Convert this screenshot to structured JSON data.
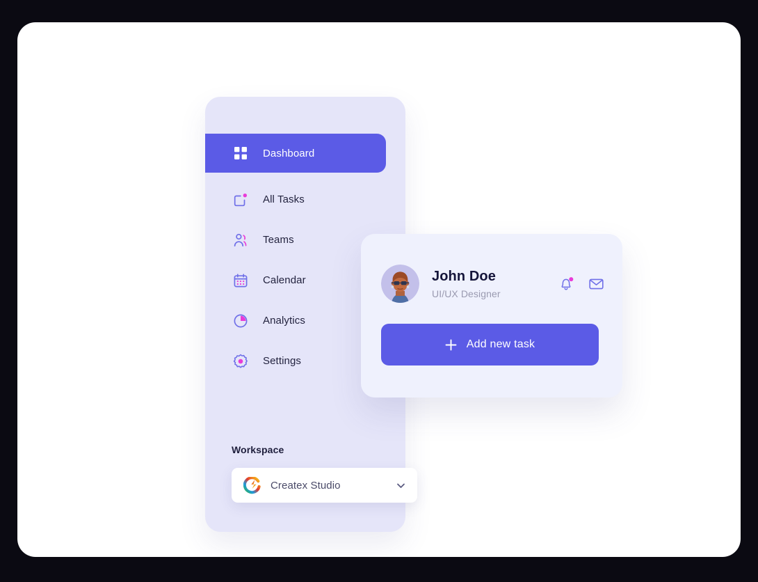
{
  "theme": {
    "page_background": "#0b0a12",
    "card_background": "#ffffff",
    "sidebar_background": "#e5e5f9",
    "accent": "#5b5be6",
    "accent_secondary": "#e93bd8",
    "profile_card_background": "#eff1fd",
    "text_dark": "#23233f",
    "text_muted": "#9a9ab0"
  },
  "sidebar": {
    "items": [
      {
        "label": "Dashboard",
        "icon": "grid-icon",
        "active": true
      },
      {
        "label": "All Tasks",
        "icon": "tasks-icon",
        "active": false
      },
      {
        "label": "Teams",
        "icon": "teams-icon",
        "active": false
      },
      {
        "label": "Calendar",
        "icon": "calendar-icon",
        "active": false
      },
      {
        "label": "Analytics",
        "icon": "analytics-icon",
        "active": false
      },
      {
        "label": "Settings",
        "icon": "settings-icon",
        "active": false
      }
    ],
    "workspace": {
      "title": "Workspace",
      "selected": "Createx Studio",
      "logo_icon": "createx-logo-icon",
      "chevron_icon": "chevron-down-icon"
    }
  },
  "profile_card": {
    "avatar_icon": "user-avatar",
    "name": "John Doe",
    "role": "UI/UX Designer",
    "actions": [
      {
        "icon": "bell-icon",
        "has_badge": true
      },
      {
        "icon": "envelope-icon",
        "has_badge": false
      }
    ],
    "add_task": {
      "label": "Add new task",
      "icon": "plus-icon"
    }
  }
}
